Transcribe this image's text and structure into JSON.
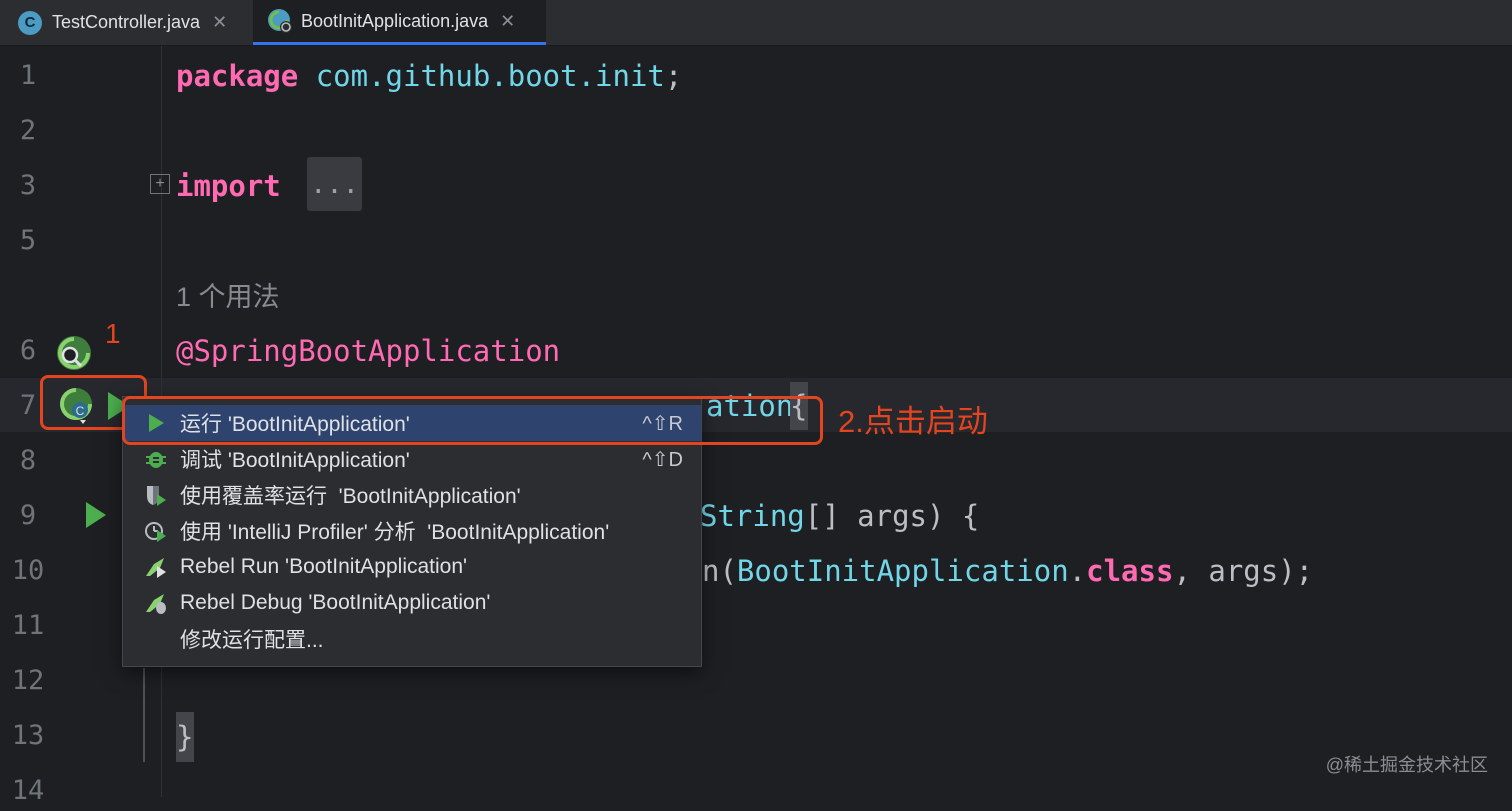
{
  "tabs": [
    {
      "label": "TestController.java",
      "icon": "class-c-icon",
      "icon_letter": "C",
      "active": false
    },
    {
      "label": "BootInitApplication.java",
      "icon": "spring-boot-class-icon",
      "active": true
    }
  ],
  "tab_close_glyph": "✕",
  "line_numbers": {
    "l1": "1",
    "l2": "2",
    "l3": "3",
    "l5": "5",
    "l6": "6",
    "l7": "7",
    "l8": "8",
    "l9": "9",
    "l10": "10",
    "l11": "11",
    "l12": "12",
    "l13": "13",
    "l14": "14"
  },
  "code": {
    "package_kw": "package",
    "package_name": "com.github.boot.init",
    "semicolon": ";",
    "import_kw": "import",
    "import_folded": "...",
    "usage_hint": "1 个用法",
    "annotation": "@SpringBootApplication",
    "class_decl_visible": "ation",
    "class_brace": "{",
    "main_visible_type": "String",
    "main_visible_rest": "[] args) {",
    "run_visible_start": "n(",
    "run_class": "BootInitApplication",
    "run_dot": ".",
    "run_class_kw": "class",
    "run_rest": ", args);",
    "close_brace": "}"
  },
  "annotations_overlay": {
    "marker1": "1",
    "marker2": "2.点击启动",
    "color": "#e2451f"
  },
  "popup": {
    "items": [
      {
        "label": "运行 'BootInitApplication'",
        "shortcut": "^⇧R",
        "icon": "run-icon",
        "selected": true
      },
      {
        "label": "调试 'BootInitApplication'",
        "shortcut": "^⇧D",
        "icon": "debug-icon"
      },
      {
        "label": "使用覆盖率运行  'BootInitApplication'",
        "shortcut": "",
        "icon": "coverage-icon"
      },
      {
        "label": "使用 'IntelliJ Profiler' 分析  'BootInitApplication'",
        "shortcut": "",
        "icon": "profiler-icon"
      },
      {
        "label": "Rebel Run 'BootInitApplication'",
        "shortcut": "",
        "icon": "rebel-run-icon"
      },
      {
        "label": "Rebel Debug 'BootInitApplication'",
        "shortcut": "",
        "icon": "rebel-debug-icon"
      },
      {
        "label": "修改运行配置...",
        "shortcut": "",
        "icon": ""
      }
    ]
  },
  "watermark": "@稀土掘金技术社区",
  "colors": {
    "editor_bg": "#1e1f22",
    "keyword": "#ff6ab3",
    "identifier": "#70d6e8",
    "run_green": "#4cae4f",
    "selection": "#2e436e"
  }
}
